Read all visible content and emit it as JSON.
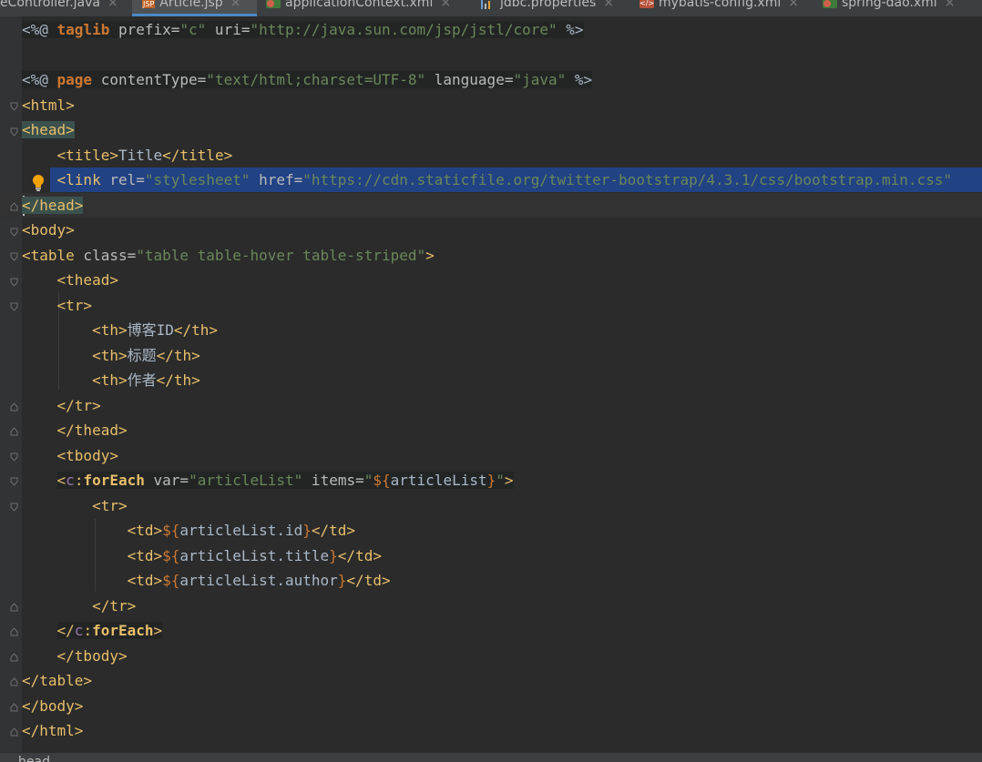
{
  "tabs": [
    {
      "label": "eController.java",
      "icon": "java-file-icon",
      "active": false
    },
    {
      "label": "Article.jsp",
      "icon": "jsp-file-icon",
      "active": true
    },
    {
      "label": "applicationContext.xml",
      "icon": "spring-xml-file-icon",
      "active": false
    },
    {
      "label": "jdbc.properties",
      "icon": "properties-file-icon",
      "active": false
    },
    {
      "label": "mybatis-config.xml",
      "icon": "mybatis-xml-file-icon",
      "active": false
    },
    {
      "label": "spring-dao.xml",
      "icon": "spring-xml-file-icon",
      "active": false
    }
  ],
  "close_glyph": "×",
  "colors": {
    "background": "#2b2b2b",
    "selection": "#214283",
    "tag": "#e8bf6a",
    "attribute": "#bababa",
    "string": "#6a8759",
    "keyword": "#cc7832",
    "namespace": "#9876aa",
    "text": "#a9b7c6"
  },
  "code": {
    "l1": {
      "open": "<%@ ",
      "kw": "taglib",
      "a1": " prefix=",
      "v1": "\"c\"",
      "a2": " uri=",
      "v2": "\"http://java.sun.com/jsp/jstl/core\"",
      "close": " %>"
    },
    "l3": {
      "open": "<%@ ",
      "kw": "page",
      "a1": " contentType=",
      "v1": "\"text/html;charset=UTF-8\"",
      "a2": " language=",
      "v2": "\"java\"",
      "close": " %>"
    },
    "l4": "<html>",
    "l5": "<head>",
    "l6": {
      "open": "<title>",
      "text": "Title",
      "close": "</title>"
    },
    "l7": {
      "open": "<link",
      "a1": " rel=",
      "v1": "\"stylesheet\"",
      "a2": " href=",
      "v2": "\"https://cdn.staticfile.org/twitter-bootstrap/4.3.1/css/bootstrap.min.css\""
    },
    "l8": "</head>",
    "l9": "<body>",
    "l10": {
      "open": "<table",
      "a1": " class=",
      "v1": "\"table table-hover table-striped\"",
      "close": ">"
    },
    "l11": "<thead>",
    "l12": "<tr>",
    "l13": {
      "open": "<th>",
      "text": "博客ID",
      "close": "</th>"
    },
    "l14": {
      "open": "<th>",
      "text": "标题",
      "close": "</th>"
    },
    "l15": {
      "open": "<th>",
      "text": "作者",
      "close": "</th>"
    },
    "l16": "</tr>",
    "l17": "</thead>",
    "l18": "<tbody>",
    "l19": {
      "lt": "<",
      "ns": "c",
      "colon": ":",
      "tag": "forEach",
      "a1": " var=",
      "v1": "\"articleList\"",
      "a2": " items=",
      "q1": "\"",
      "d1": "${",
      "expr": "articleList",
      "d2": "}",
      "q2": "\"",
      "close": ">"
    },
    "l20": "<tr>",
    "l21": {
      "open": "<td>",
      "d1": "${",
      "expr": "articleList.id",
      "d2": "}",
      "close": "</td>"
    },
    "l22": {
      "open": "<td>",
      "d1": "${",
      "expr": "articleList.title",
      "d2": "}",
      "close": "</td>"
    },
    "l23": {
      "open": "<td>",
      "d1": "${",
      "expr": "articleList.author",
      "d2": "}",
      "close": "</td>"
    },
    "l24": "</tr>",
    "l25": {
      "lt": "</",
      "ns": "c",
      "colon": ":",
      "tag": "forEach",
      "close": ">"
    },
    "l26": "</tbody>",
    "l27": "</table>",
    "l28": "</body>",
    "l29": "</html>"
  },
  "breadcrumb": "head"
}
